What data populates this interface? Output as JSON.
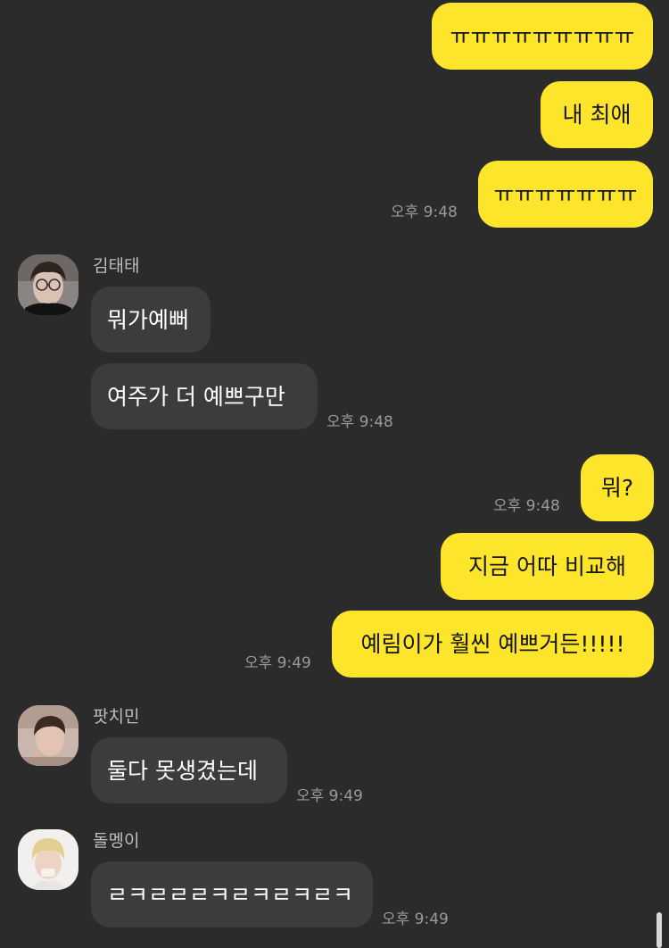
{
  "colors": {
    "background": "#2b2b2c",
    "my_bubble": "#fde52b",
    "their_bubble": "#3c3c3e",
    "timestamp": "#9a9a9c"
  },
  "messages": {
    "m1": "ㅠㅠㅠㅠㅠㅠㅠㅠㅠ",
    "m2": "내 최애",
    "m3": "ㅠㅠㅠㅠㅠㅠㅠ",
    "m4": "뭐가예뻐",
    "m5": "여주가 더 예쁘구만",
    "m6": "뭐?",
    "m7": "지금 어따 비교해",
    "m8": "예림이가 훨씬 예쁘거든!!!!!",
    "m9": "둘다 못생겼는데",
    "m10": "ㄹㅋㄹㄹㄹㅋㄹㅋㄹㅋㄹㅋ"
  },
  "timestamps": {
    "t1": "오후 9:48",
    "t2": "오후 9:48",
    "t3": "오후 9:48",
    "t4": "오후 9:49",
    "t5": "오후 9:49",
    "t6": "오후 9:49"
  },
  "senders": {
    "taetae": {
      "name": "김태태",
      "avatar_icon": "profile-photo-taetae"
    },
    "jimin": {
      "name": "팟치민",
      "avatar_icon": "profile-photo-jimin"
    },
    "dolmengi": {
      "name": "돌멩이",
      "avatar_icon": "profile-photo-dolmengi"
    }
  }
}
